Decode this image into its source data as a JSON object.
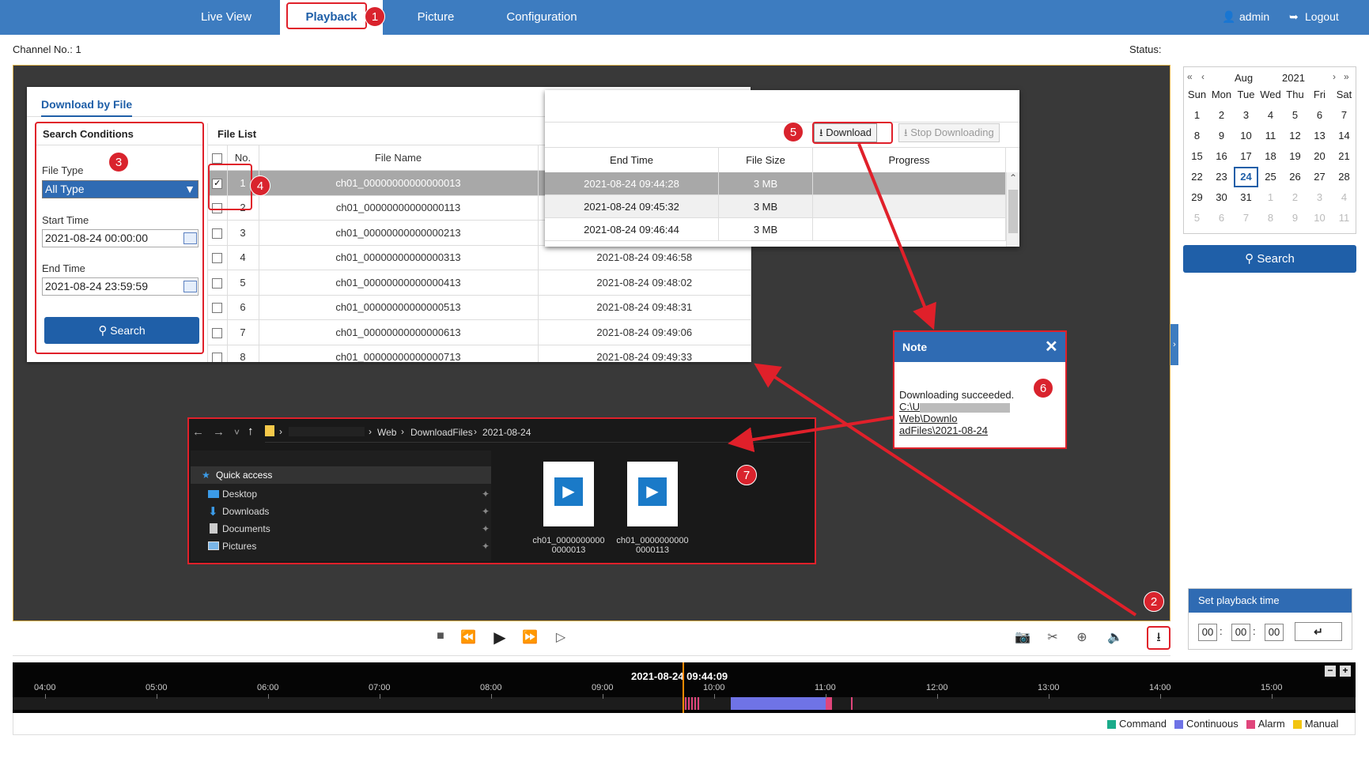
{
  "nav": {
    "tabs": [
      "Live View",
      "Playback",
      "Picture",
      "Configuration"
    ],
    "user": "admin",
    "logout": "Logout"
  },
  "header": {
    "channel_label": "Channel No.: 1",
    "status_label": "Status:"
  },
  "steps": [
    "1",
    "2",
    "3",
    "4",
    "5",
    "6",
    "7"
  ],
  "download": {
    "title": "Download by File",
    "search_conditions": "Search Conditions",
    "file_type_label": "File Type",
    "file_type_value": "All Type",
    "start_time_label": "Start Time",
    "start_time_value": "2021-08-24 00:00:00",
    "end_time_label": "End Time",
    "end_time_value": "2021-08-24 23:59:59",
    "search_button": "Search",
    "file_list_title": "File List",
    "columns": [
      "No.",
      "File Name"
    ],
    "rows": [
      {
        "no": "1",
        "name": "ch01_00000000000000013",
        "end": "2021-08-24 09:44:28"
      },
      {
        "no": "2",
        "name": "ch01_00000000000000113",
        "end": "2021-08-24 09:45:32"
      },
      {
        "no": "3",
        "name": "ch01_00000000000000213",
        "end": "2021-08-24 09:46:44"
      },
      {
        "no": "4",
        "name": "ch01_00000000000000313",
        "end": "2021-08-24 09:46:58"
      },
      {
        "no": "5",
        "name": "ch01_00000000000000413",
        "end": "2021-08-24 09:48:02"
      },
      {
        "no": "6",
        "name": "ch01_00000000000000513",
        "end": "2021-08-24 09:48:31"
      },
      {
        "no": "7",
        "name": "ch01_00000000000000613",
        "end": "2021-08-24 09:49:06"
      },
      {
        "no": "8",
        "name": "ch01_00000000000000713",
        "end": "2021-08-24 09:49:33"
      }
    ]
  },
  "overlay": {
    "download_button": "Download",
    "stop_button": "Stop Downloading",
    "columns": [
      "End Time",
      "File Size",
      "Progress"
    ],
    "rows": [
      {
        "end": "2021-08-24 09:44:28",
        "size": "3 MB"
      },
      {
        "end": "2021-08-24 09:45:32",
        "size": "3 MB"
      },
      {
        "end": "2021-08-24 09:46:44",
        "size": "3 MB"
      }
    ]
  },
  "note": {
    "title": "Note",
    "message": "Downloading succeeded.",
    "path_line1": "C:\\U",
    "path_line1_end": "Web\\Downlo",
    "path_line2": "adFiles\\2021-08-24"
  },
  "explorer": {
    "breadcrumb": [
      "Web",
      "DownloadFiles",
      "2021-08-24"
    ],
    "sidebar": [
      "Quick access",
      "Desktop",
      "Downloads",
      "Documents",
      "Pictures"
    ],
    "files": [
      {
        "line1": "ch01_0000000000",
        "line2": "0000013"
      },
      {
        "line1": "ch01_0000000000",
        "line2": "0000113"
      }
    ]
  },
  "calendar": {
    "month": "Aug",
    "year": "2021",
    "weekdays": [
      "Sun",
      "Mon",
      "Tue",
      "Wed",
      "Thu",
      "Fri",
      "Sat"
    ],
    "days": [
      [
        "1",
        "2",
        "3",
        "4",
        "5",
        "6",
        "7"
      ],
      [
        "8",
        "9",
        "10",
        "11",
        "12",
        "13",
        "14"
      ],
      [
        "15",
        "16",
        "17",
        "18",
        "19",
        "20",
        "21"
      ],
      [
        "22",
        "23",
        "24",
        "25",
        "26",
        "27",
        "28"
      ],
      [
        "29",
        "30",
        "31",
        "1",
        "2",
        "3",
        "4"
      ],
      [
        "5",
        "6",
        "7",
        "8",
        "9",
        "10",
        "11"
      ]
    ],
    "selected": "24",
    "search_button": "Search"
  },
  "playback_time": {
    "title": "Set playback time",
    "h": "00",
    "m": "00",
    "s": "00"
  },
  "timeline": {
    "current": "2021-08-24 09:44:09",
    "ticks": [
      "04:00",
      "05:00",
      "06:00",
      "07:00",
      "08:00",
      "09:00",
      "10:00",
      "11:00",
      "12:00",
      "13:00",
      "14:00",
      "15:00"
    ],
    "legend": [
      {
        "label": "Command",
        "color": "#1aab8a"
      },
      {
        "label": "Continuous",
        "color": "#6f73e6"
      },
      {
        "label": "Alarm",
        "color": "#e0457b"
      },
      {
        "label": "Manual",
        "color": "#f2c511"
      }
    ]
  },
  "colors": {
    "accent": "#3d7cc0",
    "highlight": "#e0202a"
  }
}
